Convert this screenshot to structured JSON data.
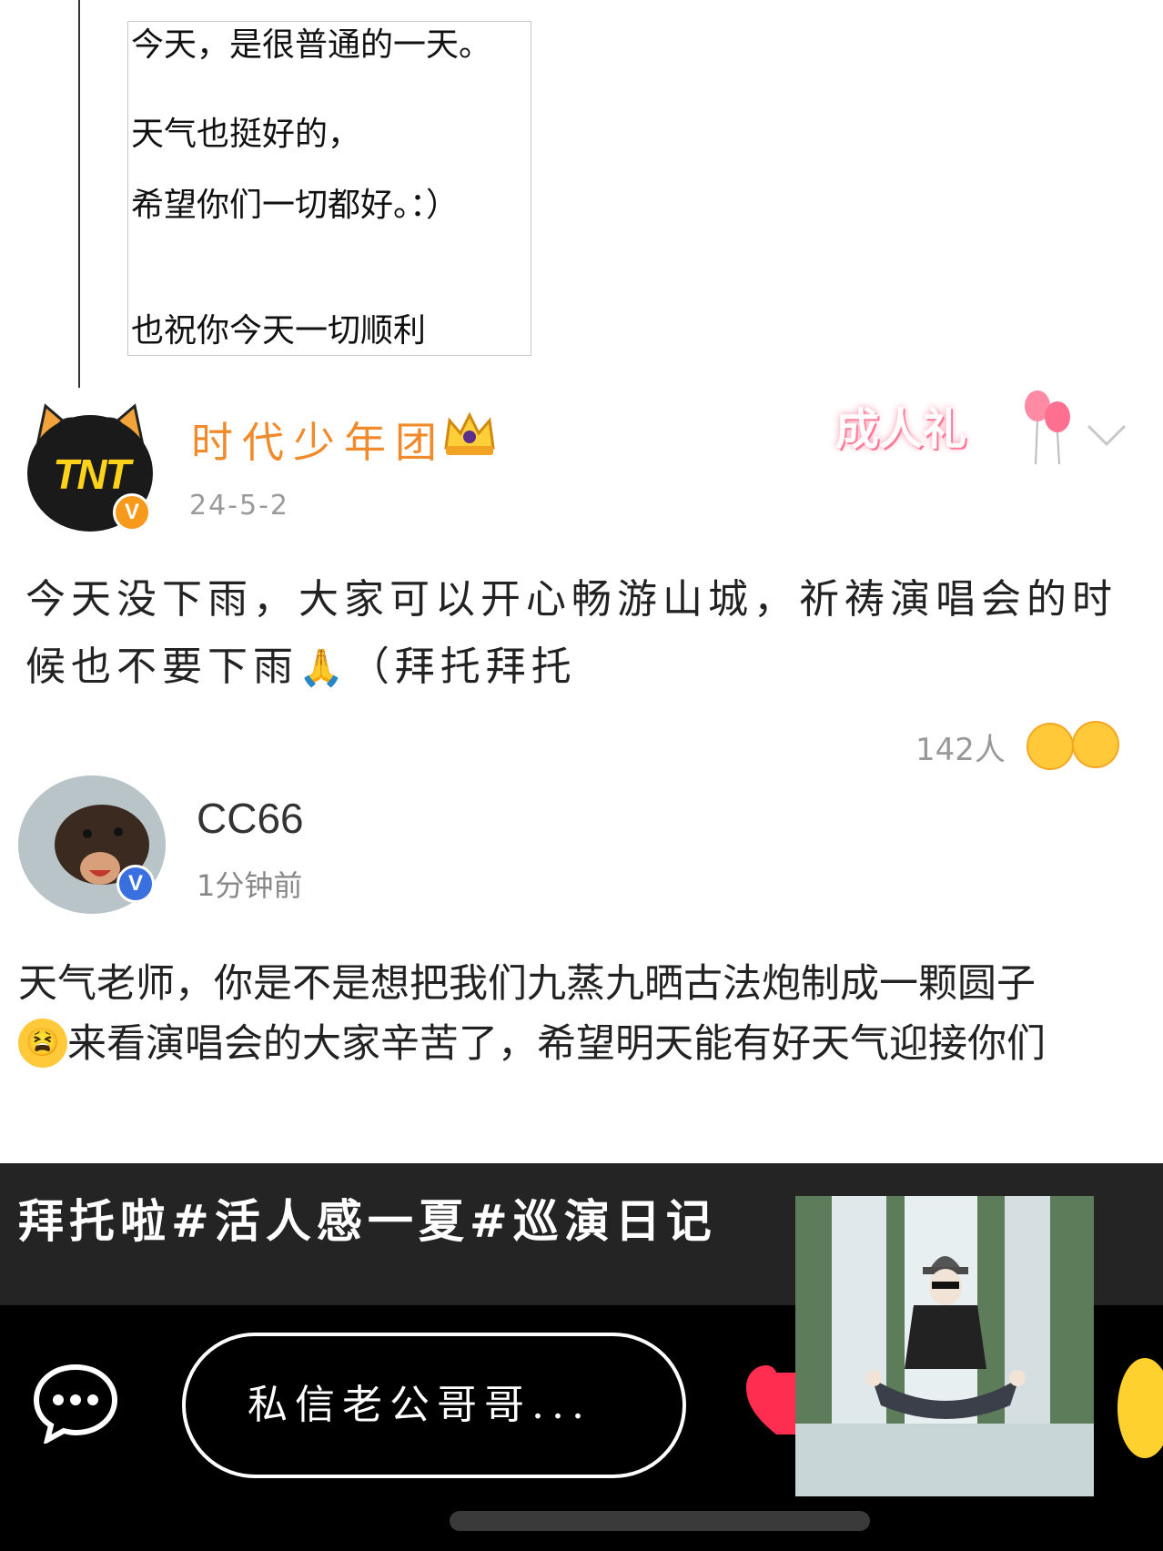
{
  "note": {
    "lines": [
      "今天，是很普通的一天。",
      "天气也挺好的，",
      "希望你们一切都好。：）",
      "也祝你今天一切顺利"
    ]
  },
  "post": {
    "author": "时代少年团",
    "date": "24-5-2",
    "avatar_logo": "TNT",
    "badge_label": "成人礼",
    "text_part1": "今天没下雨，大家可以开心畅游山城，祈祷演唱会的时候也不要下雨",
    "pray_emoji": "🙏",
    "text_part2": "（拜托拜托",
    "like_count": "142人",
    "verified": "V"
  },
  "comment": {
    "author": "CC66",
    "time": "1分钟前",
    "verified": "V",
    "line1": "天气老师，你是不是想把我们九蒸九晒古法炮制成一颗圆子",
    "tired_emoji": "😫",
    "line2": "来看演唱会的大家辛苦了，希望明天能有好天气迎接你们"
  },
  "bottom": {
    "caption": "拜托啦#活人感一夏#巡演日记",
    "dm_placeholder": "私信老公哥哥..."
  },
  "icons": [
    "crown-icon",
    "balloon-icon",
    "chevron-down-icon",
    "chat-bubble-icon",
    "heart-icon",
    "emoji-icon"
  ],
  "colors": {
    "author_orange": "#f08a2a",
    "verify_orange": "#f79a1b",
    "verify_blue": "#3a6fe0",
    "heart_red": "#ff2d4f",
    "caption_bg": "#242424",
    "action_bg": "#000000"
  }
}
